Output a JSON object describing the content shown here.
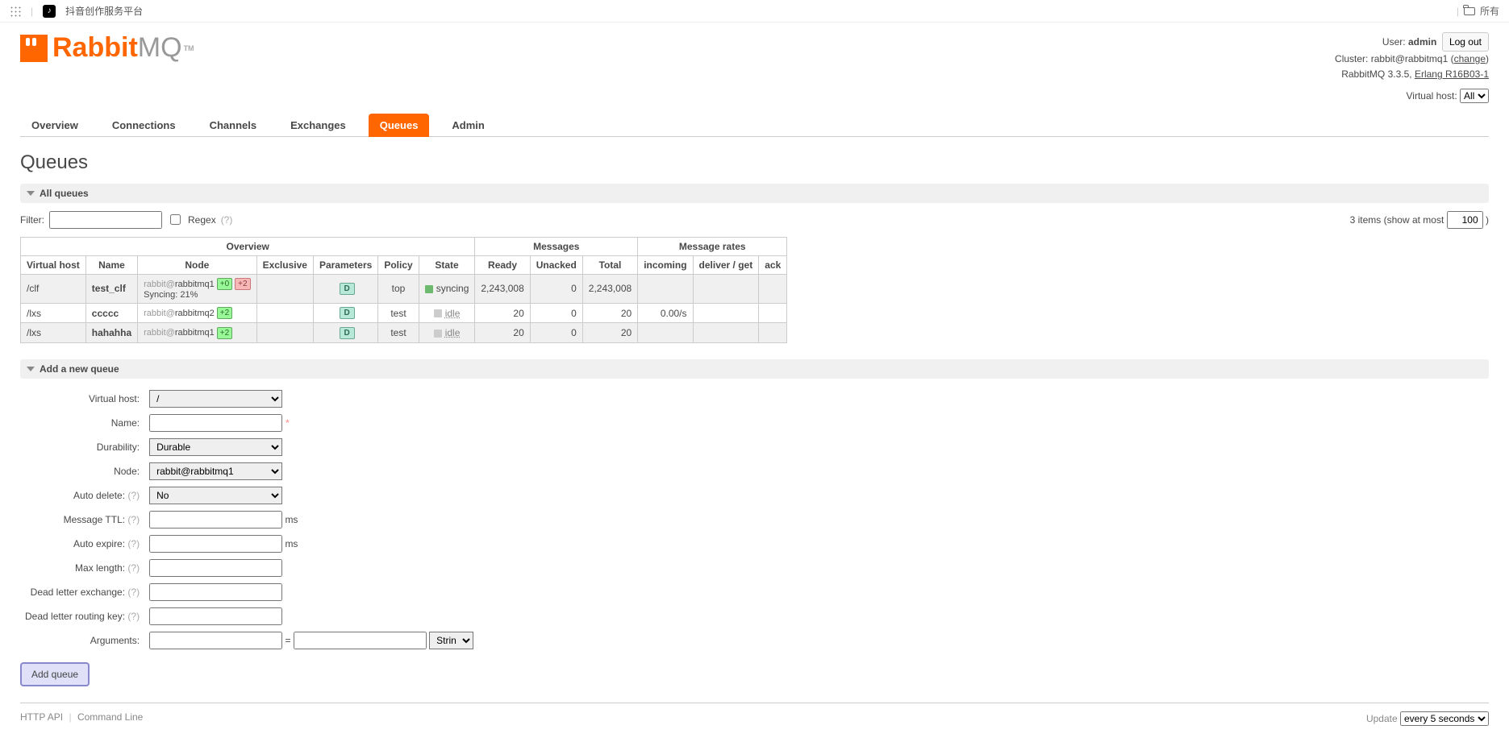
{
  "chrome": {
    "tab_title": "抖音创作服务平台",
    "right": "所有"
  },
  "logo": {
    "part1": "Rabbit",
    "part2": "MQ",
    "tm": "TM"
  },
  "header": {
    "user_label": "User:",
    "user_value": "admin",
    "cluster_label": "Cluster:",
    "cluster_value": "rabbit@rabbitmq1",
    "change": "change",
    "logout": "Log out",
    "version": "RabbitMQ 3.3.5,",
    "erlang": "Erlang R16B03-1",
    "vhost_label": "Virtual host:",
    "vhost_value": "All"
  },
  "tabs": [
    "Overview",
    "Connections",
    "Channels",
    "Exchanges",
    "Queues",
    "Admin"
  ],
  "h1": "Queues",
  "sections": {
    "all": "All queues",
    "add": "Add a new queue"
  },
  "filter": {
    "label": "Filter:",
    "regex_label": "Regex",
    "help": "(?)",
    "count_prefix": "3 items (show at most",
    "count_value": "100",
    "count_suffix": ")"
  },
  "table": {
    "group_headers": [
      "Overview",
      "Messages",
      "Message rates"
    ],
    "cols": [
      "Virtual host",
      "Name",
      "Node",
      "Exclusive",
      "Parameters",
      "Policy",
      "State",
      "Ready",
      "Unacked",
      "Total",
      "incoming",
      "deliver / get",
      "ack"
    ],
    "rows": [
      {
        "vhost": "/clf",
        "name": "test_clf",
        "node_prefix": "rabbit@",
        "node": "rabbitmq1",
        "badges": [
          "+0",
          "+2"
        ],
        "sync": "Syncing: 21%",
        "exclusive": "",
        "param": "D",
        "policy": "top",
        "state": "syncing",
        "state_kind": "sync",
        "ready": "2,243,008",
        "unacked": "0",
        "total": "2,243,008",
        "incoming": "",
        "deliver": "",
        "ack": ""
      },
      {
        "vhost": "/lxs",
        "name": "ccccc",
        "node_prefix": "rabbit@",
        "node": "rabbitmq2",
        "badges": [
          "+2"
        ],
        "sync": "",
        "exclusive": "",
        "param": "D",
        "policy": "test",
        "state": "idle",
        "state_kind": "idle",
        "ready": "20",
        "unacked": "0",
        "total": "20",
        "incoming": "0.00/s",
        "deliver": "",
        "ack": ""
      },
      {
        "vhost": "/lxs",
        "name": "hahahha",
        "node_prefix": "rabbit@",
        "node": "rabbitmq1",
        "badges": [
          "+2"
        ],
        "sync": "",
        "exclusive": "",
        "param": "D",
        "policy": "test",
        "state": "idle",
        "state_kind": "idle",
        "ready": "20",
        "unacked": "0",
        "total": "20",
        "incoming": "",
        "deliver": "",
        "ack": ""
      }
    ]
  },
  "form": {
    "labels": {
      "vhost": "Virtual host:",
      "name": "Name:",
      "durability": "Durability:",
      "node": "Node:",
      "autodelete": "Auto delete:",
      "ttl": "Message TTL:",
      "expire": "Auto expire:",
      "maxlen": "Max length:",
      "dlx": "Dead letter exchange:",
      "dlrk": "Dead letter routing key:",
      "args": "Arguments:"
    },
    "values": {
      "vhost": "/",
      "durability": "Durable",
      "node": "rabbit@rabbitmq1",
      "autodelete": "No",
      "argtype": "String"
    },
    "units": {
      "ms": "ms"
    },
    "eq": "=",
    "help": "(?)",
    "submit": "Add queue"
  },
  "footer": {
    "http_api": "HTTP API",
    "cmdline": "Command Line",
    "update_label": "Update",
    "update_value": "every 5 seconds"
  }
}
